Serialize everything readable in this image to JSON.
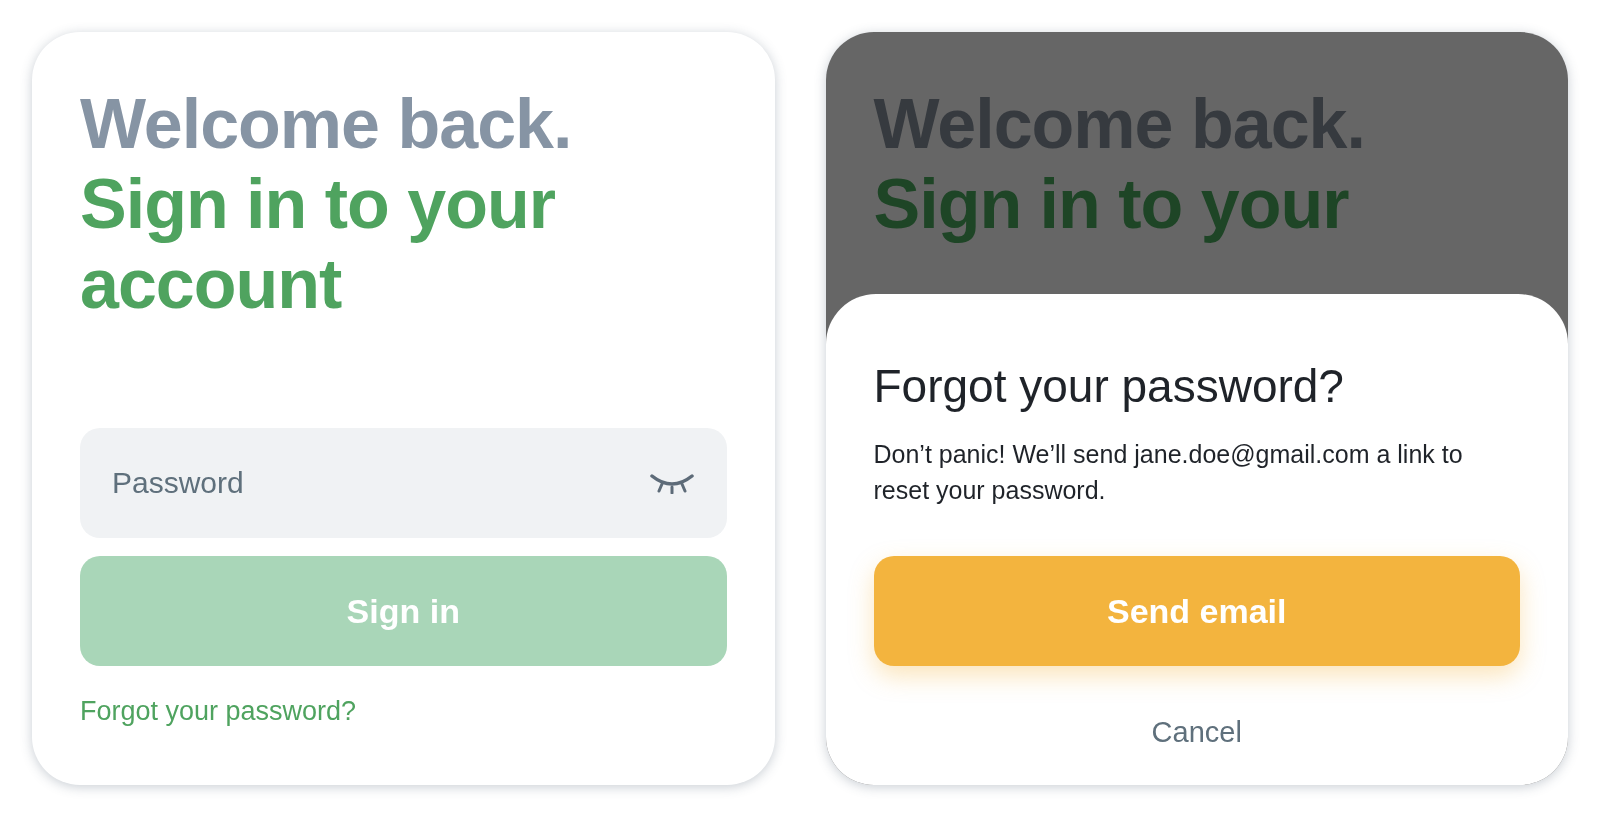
{
  "login": {
    "welcome": "Welcome back.",
    "title": "Sign in to your account",
    "password_field": {
      "placeholder": "Password",
      "masked": true
    },
    "sign_in_button": {
      "label": "Sign in",
      "disabled": true
    },
    "forgot_link": "Forgot your password?"
  },
  "reset_screen": {
    "background": {
      "welcome": "Welcome back.",
      "title": "Sign in to your"
    },
    "sheet": {
      "title": "Forgot your password?",
      "message": "Don’t panic! We’ll send jane.doe@gmail.com a link to reset your password.",
      "send_button": {
        "label": "Send email",
        "disabled": false
      },
      "cancel": "Cancel"
    }
  }
}
